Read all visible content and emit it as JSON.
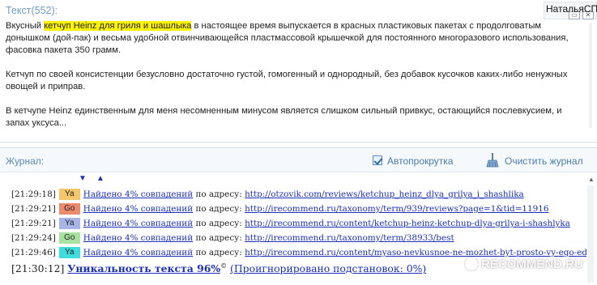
{
  "text_panel": {
    "title": "Текст(552):",
    "user_name": "НатальяСПб",
    "paragraph1": {
      "before": "Вкусный ",
      "highlight": "кетчуп Heinz для гриля и шашлыка",
      "after": " в настоящее время выпускается в красных пластиковых пакетах с продолговатым донышком (дой-пак) и весьма удобной отвинчивающейся пластмассовой крышечкой для постоянного многоразового использования, фасовка пакета 350 грамм."
    },
    "paragraph2": "Кетчуп по своей консистенции безусловно достаточно густой, гомогенный и однородный, без добавок  кусочков каких-либо ненужных овощей и приправ.",
    "paragraph3": "В кетчупе Heinz единственным для меня несомненным минусом  является слишком сильный привкус, остающийся послевкусием,  и запах уксуса..."
  },
  "journal": {
    "label": "Журнал:",
    "autoscroll_label": "Автопрокрутка",
    "autoscroll_checked": true,
    "clear_label": "Очистить журнал",
    "down_arrow": "▼",
    "up_arrow": "▲",
    "entries": [
      {
        "time": "[21:29:18]",
        "engine": "Ya",
        "engine_color": "#f3c76a",
        "match": "Найдено 4% совпадений",
        "middle": " по адресу: ",
        "url": "http://otzovik.com/reviews/ketchup_heinz_dlya_grilya_i_shashlika"
      },
      {
        "time": "[21:29:21]",
        "engine": "Go",
        "engine_color": "#ec8a6c",
        "match": "Найдено 4% совпадений",
        "middle": " по адресу: ",
        "url": "http://irecommend.ru/taxonomy/term/939/reviews?page=1&tid=11916"
      },
      {
        "time": "[21:29:21]",
        "engine": "Ya",
        "engine_color": "#a9b4e8",
        "match": "Найдено 4% совпадений",
        "middle": " по адресу: ",
        "url": "http://irecommend.ru/content/ketchup-heinz-ketchup-dlya-grilya-i-shashlyka"
      },
      {
        "time": "[21:29:24]",
        "engine": "Go",
        "engine_color": "#a8e2a1",
        "match": "Найдено 4% совпадений",
        "middle": " по адресу: ",
        "url": "http://irecommend.ru/taxonomy/term/38933/best"
      },
      {
        "time": "[21:29:46]",
        "engine": "Ya",
        "engine_color": "#3fdcdc",
        "match": "Найдено 4% совпадений",
        "middle": " по адресу: ",
        "url": "http://irecommend.ru/content/myaso-nevkusnoe-ne-mozhet-byt-prosto-vy-ego-edite-bez-ke"
      }
    ],
    "summary": {
      "time": "[21:30:12]",
      "uniqueness": "Уникальность текста 96%",
      "copyright": "©",
      "ignored": "(Проигнорировано подстановок: 0%)"
    }
  },
  "watermark": {
    "text": "RECOMMEND.RU"
  }
}
